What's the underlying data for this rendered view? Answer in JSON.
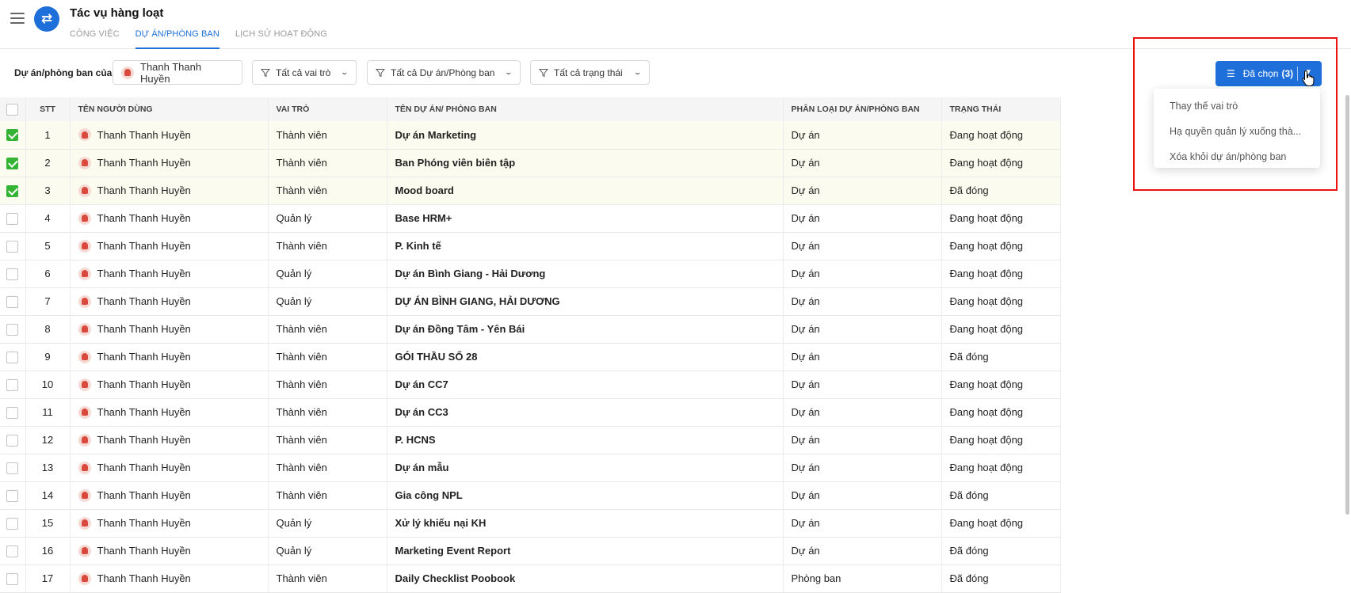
{
  "app": {
    "title": "Tác vụ hàng loạt"
  },
  "tabs": [
    {
      "label": "CÔNG VIỆC",
      "active": false
    },
    {
      "label": "DỰ ÁN/PHÒNG BAN",
      "active": true
    },
    {
      "label": "LỊCH SỬ HOẠT ĐỘNG",
      "active": false
    }
  ],
  "filters": {
    "label": "Dự án/phòng ban của:",
    "user": "Thanh Thanh Huyền",
    "role": "Tất cả vai trò",
    "project": "Tất cả Dự án/Phòng ban",
    "status": "Tất cả trạng thái"
  },
  "selected_button": {
    "label": "Đã chọn",
    "count": "(3)"
  },
  "dropdown": {
    "items": [
      "Thay thế vai trò",
      "Hạ quyền quản lý xuống thà...",
      "Xóa khỏi dự án/phòng ban"
    ]
  },
  "table": {
    "headers": {
      "stt": "STT",
      "user": "TÊN NGƯỜI DÙNG",
      "role": "VAI TRÒ",
      "project": "TÊN DỰ ÁN/ PHÒNG BAN",
      "type": "PHÂN LOẠI DỰ ÁN/PHÒNG BAN",
      "status": "TRẠNG THÁI"
    },
    "rows": [
      {
        "checked": true,
        "stt": "1",
        "user": "Thanh Thanh Huyền",
        "role": "Thành viên",
        "project": "Dự án Marketing",
        "type": "Dự án",
        "status": "Đang hoạt động"
      },
      {
        "checked": true,
        "stt": "2",
        "user": "Thanh Thanh Huyền",
        "role": "Thành viên",
        "project": "Ban Phóng viên biên tập",
        "type": "Dự án",
        "status": "Đang hoạt động"
      },
      {
        "checked": true,
        "stt": "3",
        "user": "Thanh Thanh Huyền",
        "role": "Thành viên",
        "project": "Mood board",
        "type": "Dự án",
        "status": "Đã đóng"
      },
      {
        "checked": false,
        "stt": "4",
        "user": "Thanh Thanh Huyền",
        "role": "Quản lý",
        "project": "Base HRM+",
        "type": "Dự án",
        "status": "Đang hoạt động"
      },
      {
        "checked": false,
        "stt": "5",
        "user": "Thanh Thanh Huyền",
        "role": "Thành viên",
        "project": "P. Kinh tế",
        "type": "Dự án",
        "status": "Đang hoạt động"
      },
      {
        "checked": false,
        "stt": "6",
        "user": "Thanh Thanh Huyền",
        "role": "Quản lý",
        "project": "Dự án Bình Giang - Hải Dương",
        "type": "Dự án",
        "status": "Đang hoạt động"
      },
      {
        "checked": false,
        "stt": "7",
        "user": "Thanh Thanh Huyền",
        "role": "Quản lý",
        "project": "DỰ ÁN BÌNH GIANG, HẢI DƯƠNG",
        "type": "Dự án",
        "status": "Đang hoạt động"
      },
      {
        "checked": false,
        "stt": "8",
        "user": "Thanh Thanh Huyền",
        "role": "Thành viên",
        "project": "Dự án Đồng Tâm - Yên Bái",
        "type": "Dự án",
        "status": "Đang hoạt động"
      },
      {
        "checked": false,
        "stt": "9",
        "user": "Thanh Thanh Huyền",
        "role": "Thành viên",
        "project": "GÓI THẦU SỐ 28",
        "type": "Dự án",
        "status": "Đã đóng"
      },
      {
        "checked": false,
        "stt": "10",
        "user": "Thanh Thanh Huyền",
        "role": "Thành viên",
        "project": "Dự án CC7",
        "type": "Dự án",
        "status": "Đang hoạt động"
      },
      {
        "checked": false,
        "stt": "11",
        "user": "Thanh Thanh Huyền",
        "role": "Thành viên",
        "project": "Dự án CC3",
        "type": "Dự án",
        "status": "Đang hoạt động"
      },
      {
        "checked": false,
        "stt": "12",
        "user": "Thanh Thanh Huyền",
        "role": "Thành viên",
        "project": "P. HCNS",
        "type": "Dự án",
        "status": "Đang hoạt động"
      },
      {
        "checked": false,
        "stt": "13",
        "user": "Thanh Thanh Huyền",
        "role": "Thành viên",
        "project": "Dự án mẫu",
        "type": "Dự án",
        "status": "Đang hoạt động"
      },
      {
        "checked": false,
        "stt": "14",
        "user": "Thanh Thanh Huyền",
        "role": "Thành viên",
        "project": "Gia công NPL",
        "type": "Dự án",
        "status": "Đã đóng"
      },
      {
        "checked": false,
        "stt": "15",
        "user": "Thanh Thanh Huyền",
        "role": "Quản lý",
        "project": "Xử lý khiếu nại KH",
        "type": "Dự án",
        "status": "Đang hoạt động"
      },
      {
        "checked": false,
        "stt": "16",
        "user": "Thanh Thanh Huyền",
        "role": "Quản lý",
        "project": "Marketing Event Report",
        "type": "Dự án",
        "status": "Đã đóng"
      },
      {
        "checked": false,
        "stt": "17",
        "user": "Thanh Thanh Huyền",
        "role": "Thành viên",
        "project": "Daily Checklist Poobook",
        "type": "Phòng ban",
        "status": "Đã đóng"
      }
    ]
  }
}
